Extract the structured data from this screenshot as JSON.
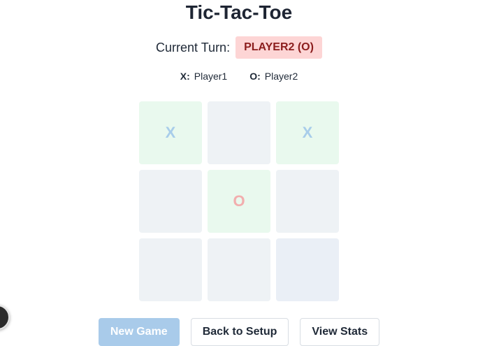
{
  "title": "Tic-Tac-Toe",
  "turn": {
    "label": "Current Turn:",
    "value": "PLAYER2 (O)"
  },
  "players": [
    {
      "symbol": "X:",
      "name": "Player1"
    },
    {
      "symbol": "O:",
      "name": "Player2"
    }
  ],
  "board": {
    "cells": [
      "X",
      "",
      "X",
      "",
      "O",
      "",
      "",
      "",
      ""
    ],
    "highlighted_cells": [
      0,
      2,
      4
    ]
  },
  "buttons": {
    "new_game": "New Game",
    "back_to_setup": "Back to Setup",
    "view_stats": "View Stats"
  },
  "colors": {
    "x_mark": "#a8cdea",
    "o_mark": "#f2aeae",
    "turn_badge_bg": "#fdd5d5",
    "primary_button": "#a9cbea",
    "highlight_cell": "#e9f9ee",
    "empty_cell": "#eef2f5"
  }
}
